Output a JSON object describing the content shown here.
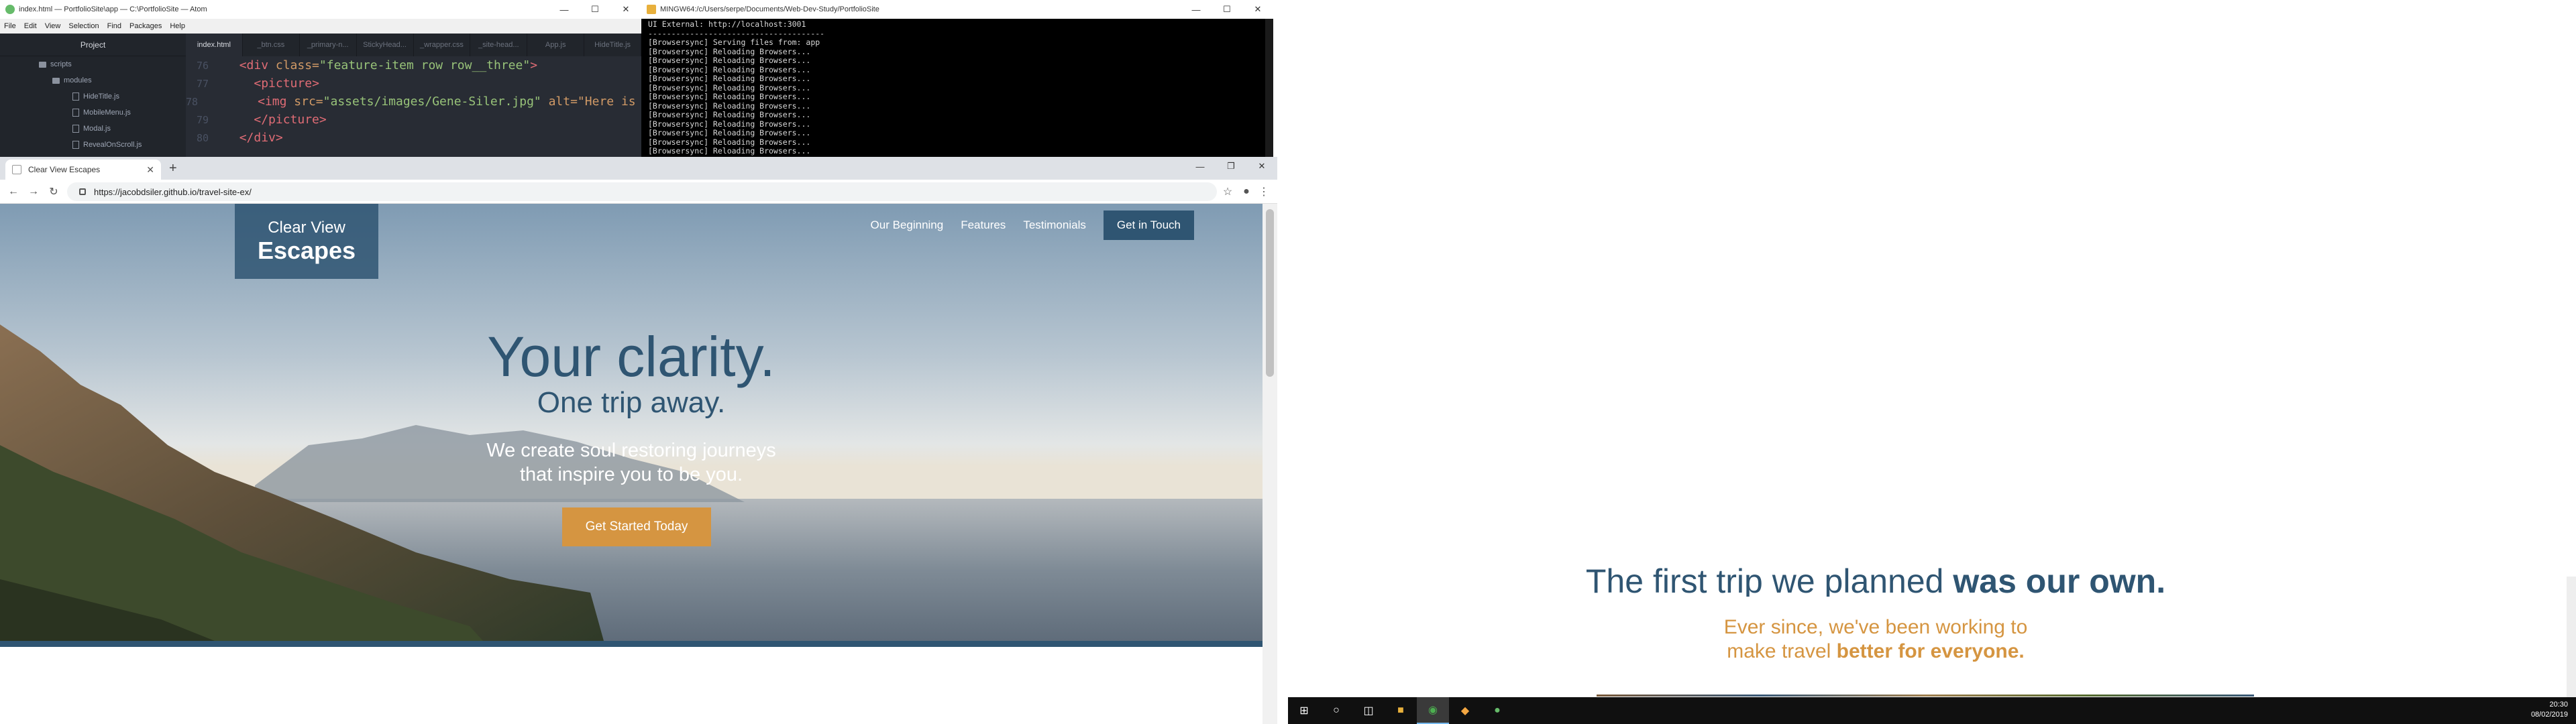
{
  "atom": {
    "title": "index.html — PortfolioSite\\app — C:\\PortfolioSite — Atom",
    "menu": [
      "File",
      "Edit",
      "View",
      "Selection",
      "Find",
      "Packages",
      "Help"
    ],
    "tree_header": "Project",
    "tree": [
      {
        "label": "scripts",
        "type": "folder"
      },
      {
        "label": "modules",
        "type": "folder"
      },
      {
        "label": "HideTitle.js",
        "type": "file"
      },
      {
        "label": "MobileMenu.js",
        "type": "file"
      },
      {
        "label": "Modal.js",
        "type": "file"
      },
      {
        "label": "RevealOnScroll.js",
        "type": "file"
      }
    ],
    "tabs": [
      "index.html",
      "_btn.css",
      "_primary-n...",
      "StickyHead...",
      "_wrapper.css",
      "_site-head...",
      "App.js",
      "HideTitle.js"
    ],
    "code_lines": [
      {
        "n": "76",
        "indent": "  ",
        "a": "<div ",
        "b": "class=",
        "c": "\"feature-item row row__three\"",
        "d": ">"
      },
      {
        "n": "77",
        "indent": "    ",
        "a": "<picture",
        "b": "",
        "c": "",
        "d": ">"
      },
      {
        "n": "78",
        "indent": "      ",
        "a": "<img ",
        "b": "src=",
        "c": "\"assets/images/Gene-Siler.jpg\"",
        "d": " alt=\"Here is a"
      },
      {
        "n": "79",
        "indent": "    ",
        "a": "</picture",
        "b": "",
        "c": "",
        "d": ">"
      },
      {
        "n": "80",
        "indent": "  ",
        "a": "</div",
        "b": "",
        "c": "",
        "d": ">"
      }
    ]
  },
  "terminal": {
    "title": "MINGW64:/c/Users/serpe/Documents/Web-Dev-Study/PortfolioSite",
    "lines": [
      "UI External: http://localhost:3001",
      "--------------------------------------",
      "[Browsersync] Serving files from: app",
      "[Browsersync] Reloading Browsers...",
      "[Browsersync] Reloading Browsers...",
      "[Browsersync] Reloading Browsers...",
      "[Browsersync] Reloading Browsers...",
      "[Browsersync] Reloading Browsers...",
      "[Browsersync] Reloading Browsers...",
      "[Browsersync] Reloading Browsers...",
      "[Browsersync] Reloading Browsers...",
      "[Browsersync] Reloading Browsers...",
      "[Browsersync] Reloading Browsers...",
      "[Browsersync] Reloading Browsers...",
      "[Browsersync] Reloading Browsers...",
      "[Browsersync] Reloading Browsers..."
    ]
  },
  "browser": {
    "tab_title": "Clear View Escapes",
    "new_tab": "+",
    "url": "https://jacobdsiler.github.io/travel-site-ex/"
  },
  "site": {
    "logo_line1": "Clear View",
    "logo_line2": "Escapes",
    "nav": [
      "Our Beginning",
      "Features",
      "Testimonials"
    ],
    "cta": "Get in Touch",
    "headline": "Your clarity.",
    "subheadline": "One trip away.",
    "tagline_1": "We create soul restoring journeys",
    "tagline_2": "that inspire you to be you.",
    "button": "Get Started Today"
  },
  "right_page": {
    "heading_a": "The first trip we planned ",
    "heading_b": "was our own.",
    "sub_1": "Ever since, we've been working to",
    "sub_2a": "make travel ",
    "sub_2b": "better for everyone."
  },
  "clock": {
    "time": "20:30",
    "date": "08/02/2019"
  },
  "colors": {
    "brand_blue": "#2f5572",
    "accent_orange": "#d59541",
    "atom_bg": "#282c34"
  }
}
